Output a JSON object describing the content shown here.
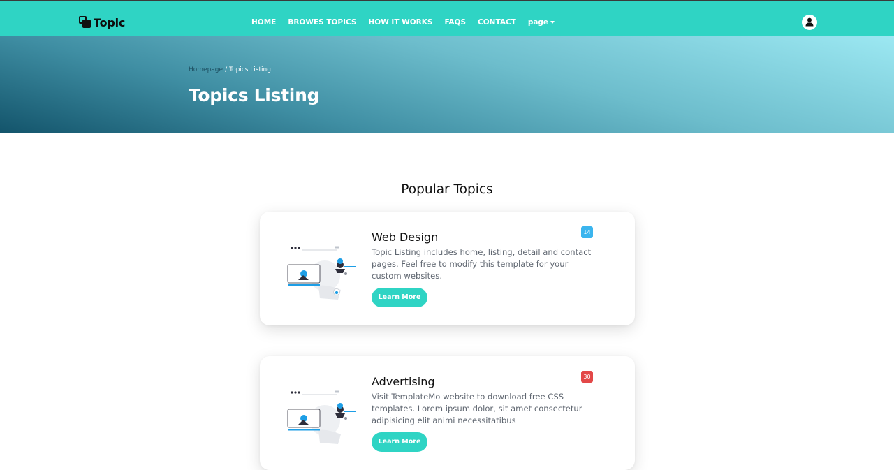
{
  "brand": {
    "name": "Topic"
  },
  "nav": {
    "items": [
      "HOME",
      "BROWES TOPICS",
      "HOW IT WORKS",
      "FAQS",
      "CONTACT"
    ],
    "dropdown_label": "page"
  },
  "hero": {
    "breadcrumb_home": "Homepage",
    "breadcrumb_sep": "/",
    "breadcrumb_current": "Topics Listing",
    "title": "Topics Listing"
  },
  "section": {
    "title": "Popular Topics"
  },
  "cards": [
    {
      "title": "Web Design",
      "description": "Topic Listing includes home, listing, detail and contact pages. Feel free to modify this template for your custom websites.",
      "badge": "14",
      "badge_color": "#3bb5ee",
      "button_label": "Learn More"
    },
    {
      "title": "Advertising",
      "description": "Visit TemplateMo website to download free CSS templates. Lorem ipsum dolor, sit amet consectetur adipisicing elit animi necessitatibus",
      "badge": "30",
      "badge_color": "#e34848",
      "button_label": "Learn More"
    }
  ],
  "colors": {
    "accent": "#2fd4c4",
    "illustration_blue": "#1d9ee6"
  }
}
